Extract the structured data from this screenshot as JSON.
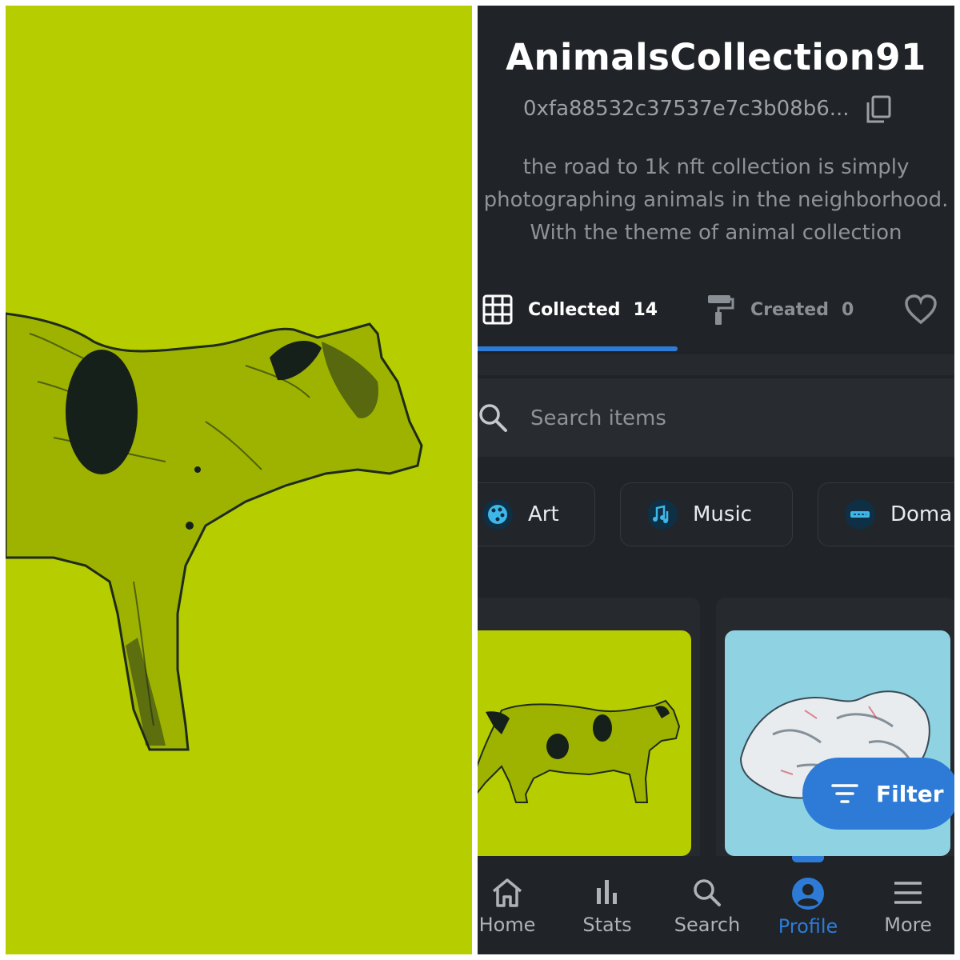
{
  "artwork": {
    "background": "#b6cd00",
    "subject": "cat-artwork"
  },
  "profile": {
    "name": "AnimalsCollection91",
    "address": "0xfa88532c37537e7c3b08b6...",
    "description": [
      "the road to 1k nft collection is simply",
      "photographing animals in the neighborhood.",
      "With the theme of animal collection"
    ]
  },
  "tabs": [
    {
      "label": "Collected",
      "count": "14",
      "icon": "grid-icon",
      "active": true
    },
    {
      "label": "Created",
      "count": "0",
      "icon": "paint-roller-icon",
      "active": false
    },
    {
      "label": "",
      "count": "",
      "icon": "heart-icon",
      "active": false
    }
  ],
  "search": {
    "placeholder": "Search items",
    "value": ""
  },
  "categories": [
    {
      "label": "Art",
      "icon": "palette-icon"
    },
    {
      "label": "Music",
      "icon": "music-notes-icon"
    },
    {
      "label": "Doma",
      "icon": "domain-icon"
    }
  ],
  "items": [
    {
      "name": "cat-artwork",
      "background": "#b6cd00"
    },
    {
      "name": "rock-artwork",
      "background": "#8fd3e2"
    }
  ],
  "filter": {
    "label": "Filter"
  },
  "nav": [
    {
      "label": "Home",
      "icon": "home-icon"
    },
    {
      "label": "Stats",
      "icon": "stats-icon"
    },
    {
      "label": "Search",
      "icon": "search-icon"
    },
    {
      "label": "Profile",
      "icon": "profile-icon",
      "active": true
    },
    {
      "label": "More",
      "icon": "menu-icon"
    }
  ],
  "colors": {
    "accent": "#2d7bd6",
    "surface": "#202327",
    "artwork_green": "#b6cd00",
    "artwork_blue": "#8fd3e2"
  }
}
